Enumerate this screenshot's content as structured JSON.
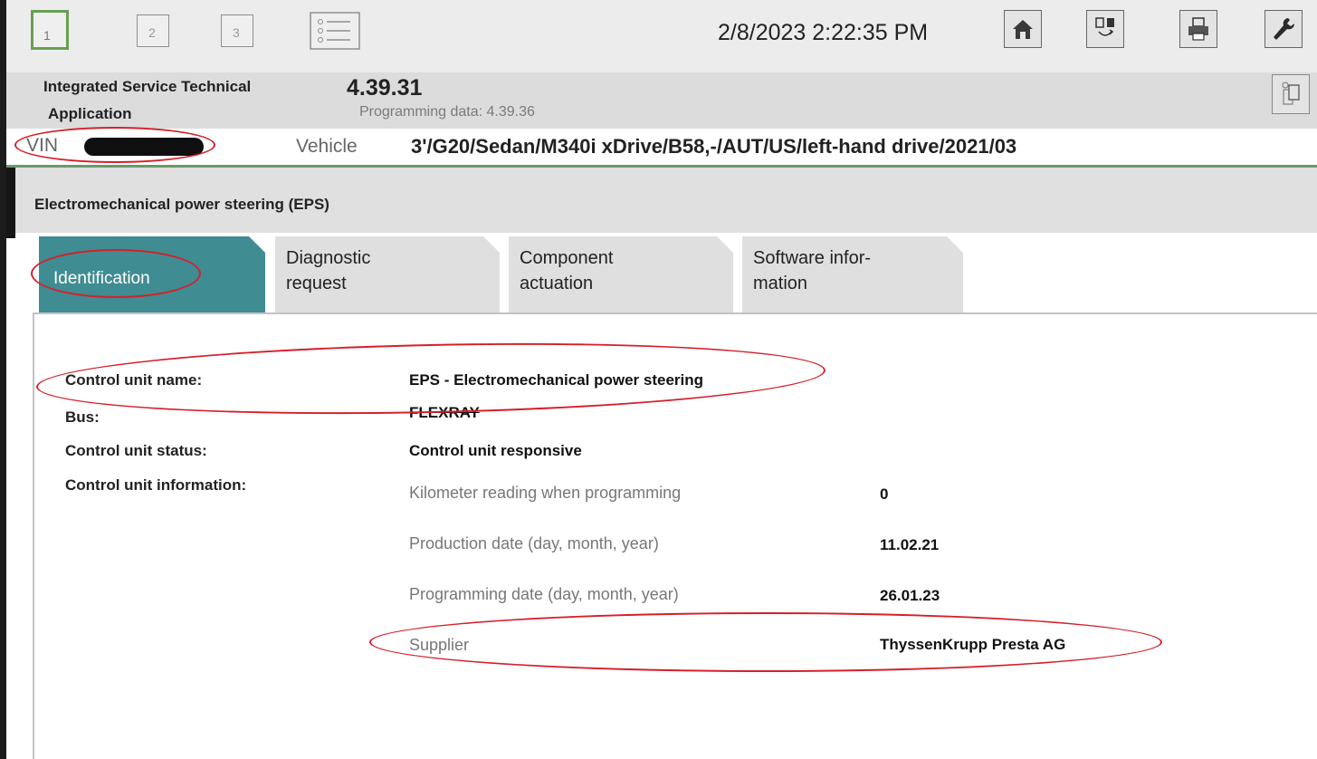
{
  "toolbar": {
    "buttons": [
      "1",
      "2",
      "3"
    ],
    "datetime": "2/8/2023 2:22:35 PM",
    "icons": [
      "list-icon",
      "home-icon",
      "vehicle-exchange-icon",
      "printer-icon",
      "wrench-icon"
    ]
  },
  "app": {
    "title_line1": "Integrated Service Technical",
    "title_line2": "Application",
    "version": "4.39.31",
    "programming_data": "Programming data:  4.39.36"
  },
  "vehicle": {
    "vin_label": "VIN",
    "label": "Vehicle",
    "value": "3'/G20/Sedan/M340i xDrive/B58,-/AUT/US/left-hand drive/2021/03"
  },
  "module": {
    "title": "Electromechanical power steering (EPS)"
  },
  "tabs": {
    "identification": "Identification",
    "diagnostic_l1": "Diagnostic",
    "diagnostic_l2": "request",
    "component_l1": "Component",
    "component_l2": "actuation",
    "software_l1": "Software infor-",
    "software_l2": "mation"
  },
  "identification": {
    "control_unit_name_label": "Control unit name:",
    "control_unit_name_value": "EPS - Electromechanical power steering",
    "bus_label": "Bus:",
    "bus_value": "FLEXRAY",
    "status_label": "Control unit status:",
    "status_value": "Control unit responsive",
    "info_label": "Control unit information:",
    "info": [
      {
        "label": "Kilometer reading when programming",
        "value": "0"
      },
      {
        "label": "Production date (day, month, year)",
        "value": "11.02.21"
      },
      {
        "label": "Programming date (day, month, year)",
        "value": "26.01.23"
      },
      {
        "label": "Supplier",
        "value": "ThyssenKrupp Presta AG"
      }
    ]
  },
  "colors": {
    "active_tab": "#3f8c92",
    "active_button_border": "#67a052",
    "annotation": "#d4202a"
  }
}
